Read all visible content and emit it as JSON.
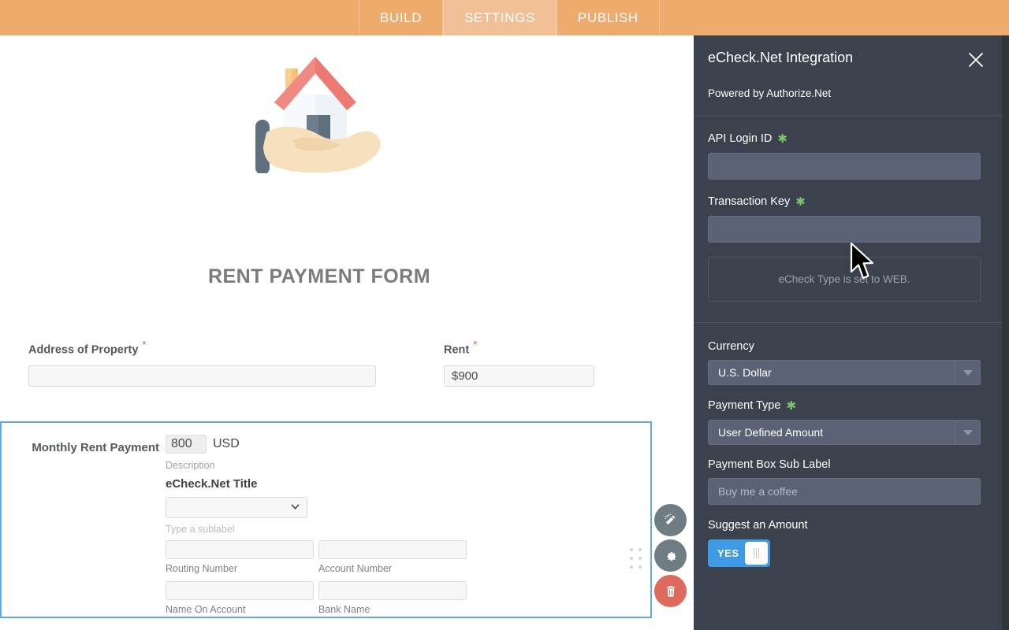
{
  "topbar": {
    "tabs": [
      {
        "label": "BUILD",
        "active": false
      },
      {
        "label": "SETTINGS",
        "active": true
      },
      {
        "label": "PUBLISH",
        "active": false
      }
    ],
    "accent_color": "#eeab6e",
    "active_tab_color": "#f2c096"
  },
  "form": {
    "title": "RENT PAYMENT FORM",
    "illustration": "hand-holding-house-icon",
    "fields": [
      {
        "label": "Address of Property",
        "required": true,
        "value": "",
        "placeholder": ""
      },
      {
        "label": "Rent",
        "required": true,
        "value": "$900",
        "placeholder": ""
      }
    ],
    "payment_box": {
      "title": "Monthly Rent Payment",
      "amount": "800",
      "currency_code": "USD",
      "description_caption": "Description",
      "echeck_title": "eCheck.Net Title",
      "echeck_select_value": "",
      "sublabel_placeholder": "Type a sublabel",
      "bank_fields": [
        {
          "caption": "Routing Number",
          "value": ""
        },
        {
          "caption": "Account Number",
          "value": ""
        },
        {
          "caption": "Name On Account",
          "value": ""
        },
        {
          "caption": "Bank Name",
          "value": ""
        }
      ],
      "selected_border_color": "#63a9e8",
      "actions": [
        {
          "name": "magic-wand-icon",
          "color": "#707c83"
        },
        {
          "name": "gear-icon",
          "color": "#707c83"
        },
        {
          "name": "trash-icon",
          "color": "#dd6a5c"
        }
      ]
    }
  },
  "panel": {
    "title": "eCheck.Net Integration",
    "subtitle": "Powered by Authorize.Net",
    "close_icon": "close-icon",
    "background_color": "#3c424d",
    "api_login": {
      "label": "API Login ID",
      "required": true,
      "value": "",
      "placeholder": ""
    },
    "transaction_key": {
      "label": "Transaction Key",
      "required": true,
      "value": "",
      "placeholder": ""
    },
    "echeck_note": "eCheck Type is set to WEB.",
    "currency": {
      "label": "Currency",
      "required": false,
      "value": "U.S. Dollar"
    },
    "payment_type": {
      "label": "Payment Type",
      "required": true,
      "value": "User Defined Amount"
    },
    "payment_box_sub_label": {
      "label": "Payment Box Sub Label",
      "value": "",
      "placeholder": "Buy me a coffee"
    },
    "suggest_amount": {
      "label": "Suggest an Amount",
      "toggle_state": "YES",
      "toggle_color": "#3f9ae5"
    }
  }
}
